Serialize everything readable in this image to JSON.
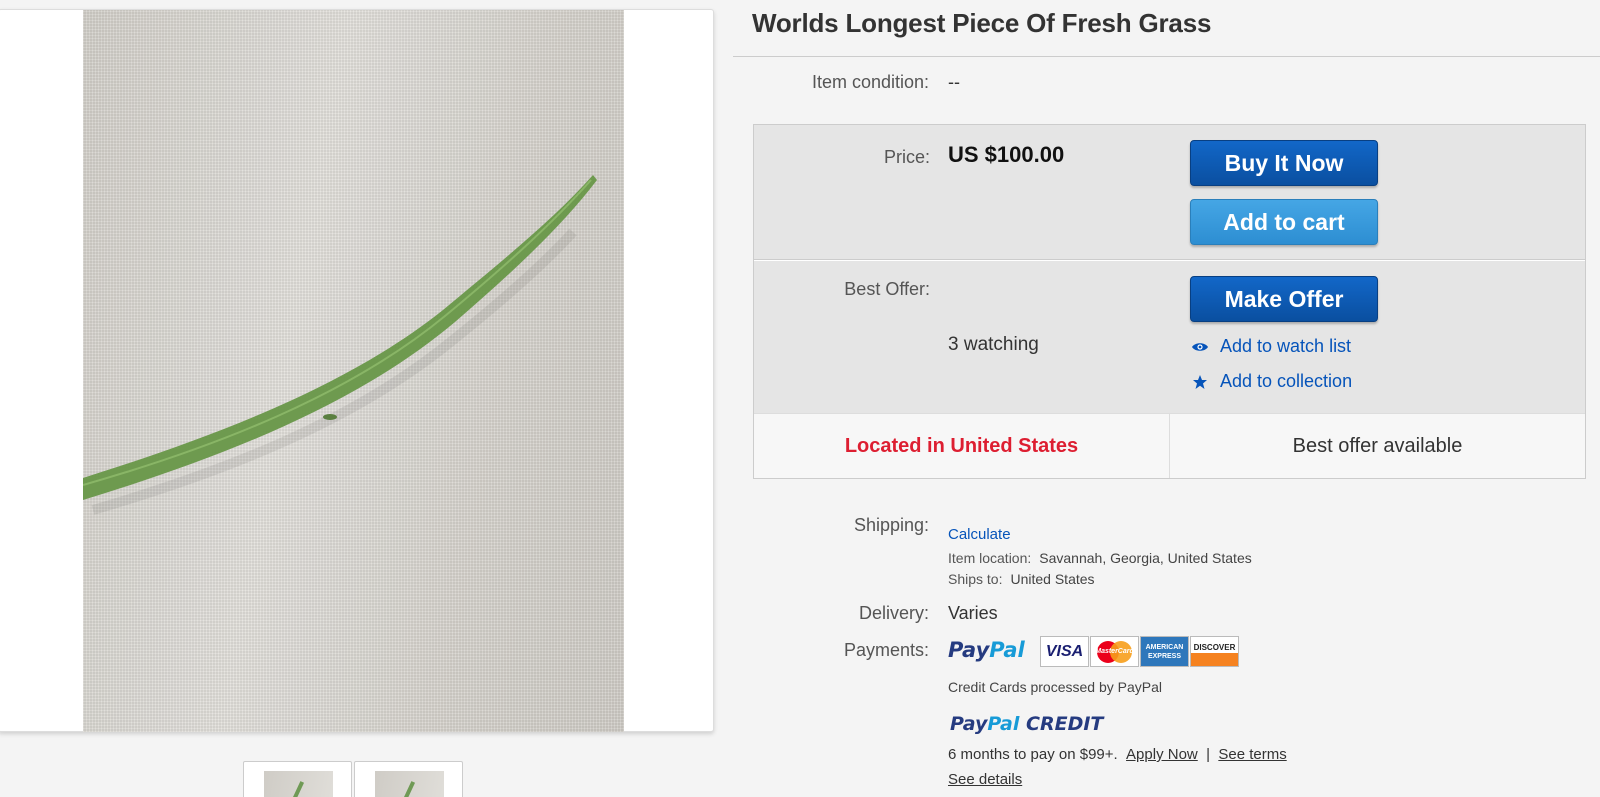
{
  "listing": {
    "title": "Worlds Longest Piece Of Fresh Grass"
  },
  "condition": {
    "label": "Item condition:",
    "value": "--"
  },
  "price": {
    "label": "Price:",
    "value": "US $100.00",
    "buy_it_now": "Buy It Now",
    "add_to_cart": "Add to cart"
  },
  "offer": {
    "label": "Best Offer:",
    "make_offer": "Make Offer",
    "watching": "3 watching",
    "watch_list": "Add to watch list",
    "collection": "Add to collection"
  },
  "strip": {
    "location": "Located in United States",
    "offer_available": "Best offer available"
  },
  "shipping": {
    "label": "Shipping:",
    "calculate": "Calculate",
    "item_location_key": "Item location:",
    "item_location_value": "Savannah, Georgia, United States",
    "ships_to_key": "Ships to:",
    "ships_to_value": "United States"
  },
  "delivery": {
    "label": "Delivery:",
    "value": "Varies"
  },
  "payments": {
    "label": "Payments:",
    "paypal_pay": "Pay",
    "paypal_pal": "Pal",
    "cards": {
      "visa": "VISA",
      "mastercard": "MasterCard",
      "amex": "AMERICAN EXPRESS",
      "discover": "DISCOVER"
    },
    "note": "Credit Cards processed by PayPal",
    "credit_pay": "Pay",
    "credit_pal": "Pal",
    "credit_word": "CREDIT",
    "credit_offer": "6 months to pay on $99+.",
    "apply_now": "Apply Now",
    "separator": "|",
    "see_terms": "See terms",
    "see_details": "See details"
  },
  "icons": {
    "eye": "eye-icon",
    "star": "star-icon"
  },
  "colors": {
    "button_dark": "#0a4fa0",
    "button_light": "#2d8ed2",
    "link": "#0654ba",
    "location_red": "#dd1e31"
  }
}
